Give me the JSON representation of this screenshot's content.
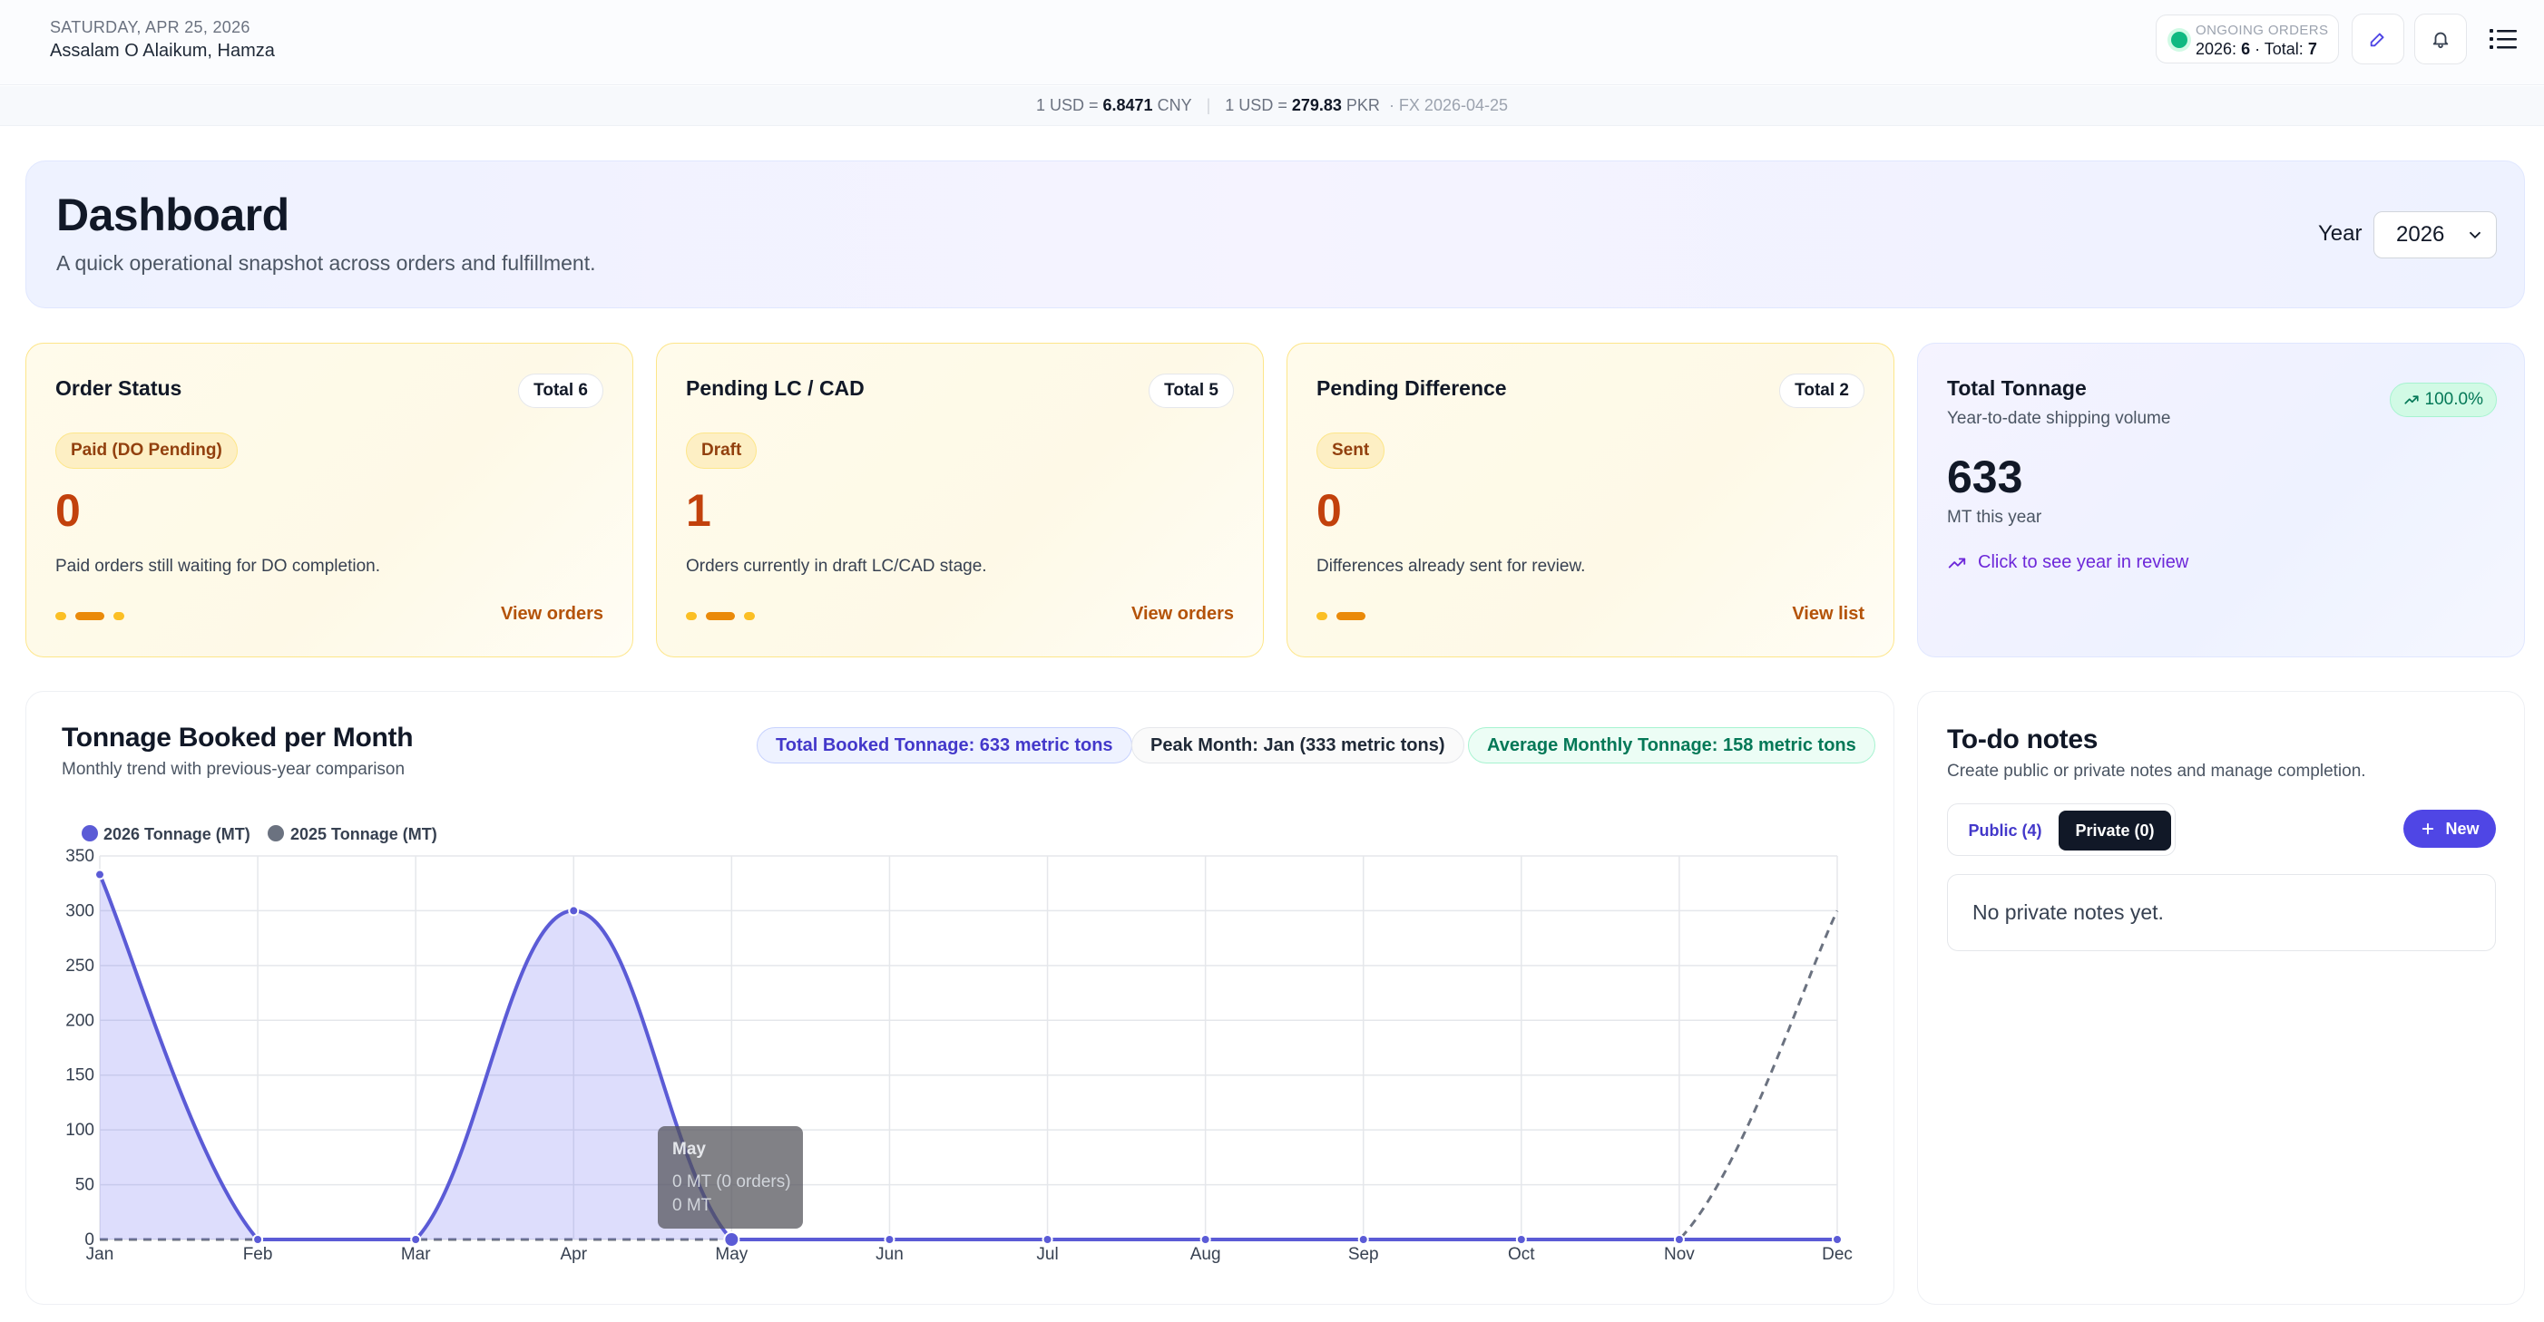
{
  "header": {
    "date": "SATURDAY, APR 25, 2026",
    "greeting": "Assalam O Alaikum, Hamza",
    "ongoing_label": "ONGOING ORDERS",
    "ongoing_year": "2026:",
    "ongoing_count": "6",
    "ongoing_total_label": "· Total:",
    "ongoing_total": "7",
    "icons": [
      "edit-icon",
      "bell-icon",
      "menu-list-icon"
    ]
  },
  "fx": {
    "usd_cny_prefix": "1 USD =",
    "usd_cny_value": "6.8471",
    "usd_cny_unit": "CNY",
    "usd_pkr_prefix": "1 USD =",
    "usd_pkr_value": "279.83",
    "usd_pkr_unit": "PKR",
    "date": "· FX 2026-04-25"
  },
  "hero": {
    "title": "Dashboard",
    "subtitle": "A quick operational snapshot across orders and fulfillment.",
    "year_label": "Year",
    "year_value": "2026"
  },
  "cards": [
    {
      "title": "Order Status",
      "total": "Total 6",
      "badge": "Paid (DO Pending)",
      "value": "0",
      "desc": "Paid orders still waiting for DO completion.",
      "link": "View orders"
    },
    {
      "title": "Pending LC / CAD",
      "total": "Total 5",
      "badge": "Draft",
      "value": "1",
      "desc": "Orders currently in draft LC/CAD stage.",
      "link": "View orders"
    },
    {
      "title": "Pending Difference",
      "total": "Total 2",
      "badge": "Sent",
      "value": "0",
      "desc": "Differences already sent for review.",
      "link": "View list"
    }
  ],
  "tonnage": {
    "title": "Total Tonnage",
    "subtitle": "Year-to-date shipping volume",
    "change": "100.0%",
    "value": "633",
    "unit": "MT this year",
    "link": "Click to see year in review"
  },
  "chart_panel": {
    "title": "Tonnage Booked per Month",
    "subtitle": "Monthly trend with previous-year comparison",
    "pill_total": "Total Booked Tonnage: 633 metric tons",
    "pill_peak": "Peak Month: Jan (333 metric tons)",
    "pill_avg": "Average Monthly Tonnage: 158 metric tons",
    "tooltip": {
      "title": "May",
      "line1": "0 MT (0 orders)",
      "line2": "0 MT"
    }
  },
  "chart_data": {
    "type": "line",
    "categories": [
      "Jan",
      "Feb",
      "Mar",
      "Apr",
      "May",
      "Jun",
      "Jul",
      "Aug",
      "Sep",
      "Oct",
      "Nov",
      "Dec"
    ],
    "series": [
      {
        "name": "2026 Tonnage (MT)",
        "values": [
          333,
          0,
          0,
          300,
          0,
          0,
          0,
          0,
          0,
          0,
          0,
          0
        ],
        "color": "#5b5bd6",
        "fill": true
      },
      {
        "name": "2025 Tonnage (MT)",
        "values": [
          0,
          0,
          0,
          0,
          0,
          0,
          0,
          0,
          0,
          0,
          0,
          300
        ],
        "color": "#6b7280",
        "dashed": true
      }
    ],
    "yticks": [
      0,
      50,
      100,
      150,
      200,
      250,
      300,
      350
    ],
    "ylim": [
      0,
      350
    ],
    "grid": true,
    "legend": "top-left"
  },
  "todo": {
    "title": "To-do notes",
    "subtitle": "Create public or private notes and manage completion.",
    "tab_public": "Public (4)",
    "tab_private": "Private (0)",
    "new_button": "New",
    "empty": "No private notes yet."
  }
}
